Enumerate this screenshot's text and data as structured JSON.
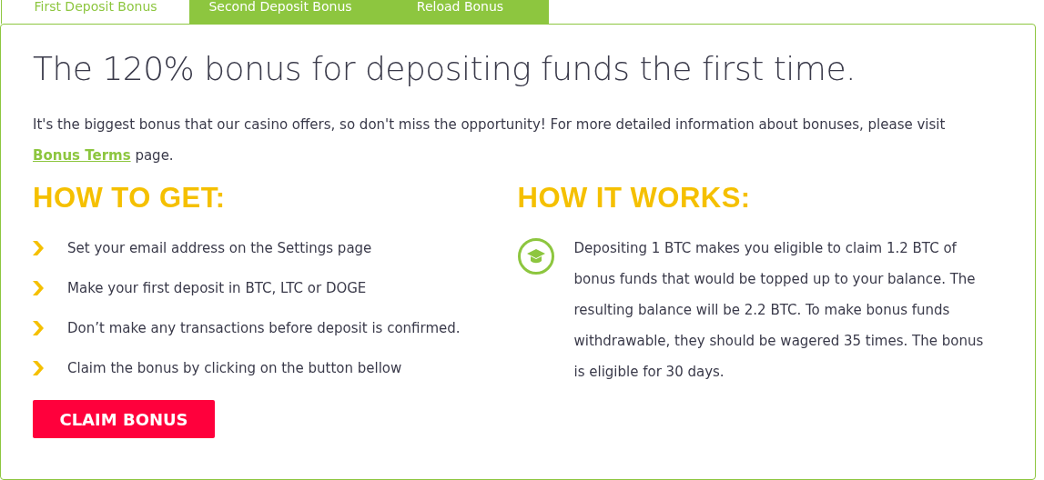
{
  "tabs": [
    {
      "label": "First Deposit Bonus",
      "selected": true
    },
    {
      "label": "Second Deposit Bonus",
      "selected": false
    },
    {
      "label": "Reload Bonus",
      "selected": false
    }
  ],
  "title": "The 120% bonus for depositing funds the first time.",
  "intro": {
    "text_before": "It's the biggest bonus that our casino offers, so don't miss the opportunity! For more detailed information about bonuses, please visit",
    "link": "Bonus Terms",
    "text_after": "page."
  },
  "how_to_get": {
    "heading": "HOW TO GET:",
    "steps": [
      "Set your email address on the Settings page",
      "Make your first deposit in BTC, LTC or DOGE",
      "Don’t make any transactions before deposit is confirmed.",
      "Claim the bonus by clicking on the button bellow"
    ],
    "button": "CLAIM BONUS"
  },
  "how_it_works": {
    "heading": "HOW IT WORKS:",
    "text": "Depositing 1 BTC makes you eligible to claim 1.2 BTC of bonus funds that would be topped up to your balance. The resulting balance will be 2.2 BTC. To make bonus funds withdrawable, they should be wagered 35 times. The bonus is eligible for 30 days."
  }
}
